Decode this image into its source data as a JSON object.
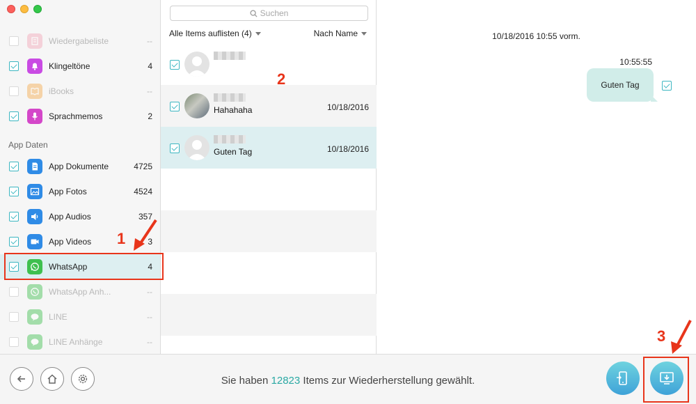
{
  "sidebar": {
    "items": [
      {
        "label": "Wiedergabeliste",
        "count": "--",
        "checked": false,
        "dim": true,
        "icon": "playlist-icon",
        "color": "#f3a6b6"
      },
      {
        "label": "Klingeltöne",
        "count": "4",
        "checked": true,
        "dim": false,
        "icon": "bell-icon",
        "color": "#c94be3"
      },
      {
        "label": "iBooks",
        "count": "--",
        "checked": false,
        "dim": true,
        "icon": "book-icon",
        "color": "#f5a94a"
      },
      {
        "label": "Sprachmemos",
        "count": "2",
        "checked": true,
        "dim": false,
        "icon": "microphone-icon",
        "color": "#d447c9"
      },
      {
        "label": "App Dokumente",
        "count": "4725",
        "checked": true,
        "dim": false,
        "icon": "document-icon",
        "color": "#2f8be6"
      },
      {
        "label": "App Fotos",
        "count": "4524",
        "checked": true,
        "dim": false,
        "icon": "photo-icon",
        "color": "#2f8be6"
      },
      {
        "label": "App Audios",
        "count": "357",
        "checked": true,
        "dim": false,
        "icon": "audio-icon",
        "color": "#2f8be6"
      },
      {
        "label": "App Videos",
        "count": "3",
        "checked": true,
        "dim": false,
        "icon": "video-icon",
        "color": "#2f8be6"
      },
      {
        "label": "WhatsApp",
        "count": "4",
        "checked": true,
        "dim": false,
        "icon": "whatsapp-icon",
        "color": "#3fc04f"
      },
      {
        "label": "WhatsApp Anh...",
        "count": "--",
        "checked": false,
        "dim": true,
        "icon": "whatsapp-attachments-icon",
        "color": "#3fc04f"
      },
      {
        "label": "LINE",
        "count": "--",
        "checked": false,
        "dim": true,
        "icon": "line-icon",
        "color": "#3fc04f"
      },
      {
        "label": "LINE Anhänge",
        "count": "--",
        "checked": false,
        "dim": true,
        "icon": "line-attachments-icon",
        "color": "#3fc04f"
      }
    ],
    "section_title": "App Daten"
  },
  "middle": {
    "search_placeholder": "Suchen",
    "filter_label": "Alle Items auflisten (4)",
    "sort_label": "Nach Name",
    "messages": [
      {
        "text": "",
        "date": ""
      },
      {
        "text": "Hahahaha",
        "date": "10/18/2016"
      },
      {
        "text": "Guten Tag",
        "date": "10/18/2016"
      }
    ]
  },
  "chat": {
    "date_header": "10/18/2016 10:55 vorm.",
    "time": "10:55:55",
    "bubble_text": "Guten Tag"
  },
  "footer": {
    "status_prefix": "Sie haben ",
    "status_count": "12823",
    "status_suffix": " Items zur Wiederherstellung gewählt."
  },
  "annotations": {
    "one": "1",
    "two": "2",
    "three": "3"
  },
  "colors": {
    "accent": "#3cb6c1",
    "highlight": "#e8351b",
    "selected_row": "#ddeff1"
  }
}
